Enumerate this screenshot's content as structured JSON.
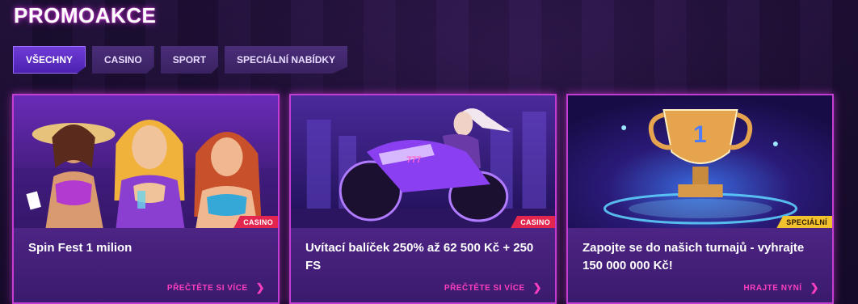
{
  "page": {
    "title": "PROMOAKCE"
  },
  "tabs": [
    {
      "label": "VŠECHNY",
      "active": true
    },
    {
      "label": "CASINO",
      "active": false
    },
    {
      "label": "SPORT",
      "active": false
    },
    {
      "label": "SPECIÁLNÍ NABÍDKY",
      "active": false
    }
  ],
  "cards": [
    {
      "title": "Spin Fest 1 milion",
      "badge": "CASINO",
      "link": "PŘEČTĚTE SI VÍCE"
    },
    {
      "title": "Uvítací balíček 250% až 62 500 Kč + 250 FS",
      "badge": "CASINO",
      "link": "PŘEČTĚTE SI VÍCE"
    },
    {
      "title": "Zapojte se do našich turnajů - vyhrajte 150 000 000 Kč!",
      "badge": "SPECIÁLNÍ",
      "link": "HRAJTE NYNÍ"
    }
  ],
  "colors": {
    "accent": "#c23dd2",
    "link": "#ff3fbf",
    "casino_badge": "#e2264f",
    "special_badge": "#f1c12e"
  },
  "icons": {
    "card_link": "chevron-right-icon"
  }
}
